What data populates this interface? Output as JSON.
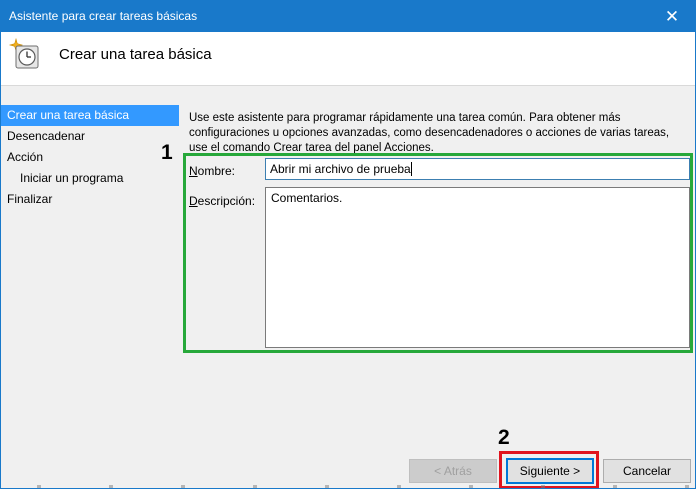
{
  "window": {
    "title": "Asistente para crear tareas básicas",
    "close_glyph": "✕"
  },
  "header": {
    "title": "Crear una tarea básica",
    "icon": "task-clock-icon"
  },
  "nav": {
    "items": [
      {
        "label": "Crear una tarea básica",
        "active": true
      },
      {
        "label": "Desencadenar"
      },
      {
        "label": "Acción"
      },
      {
        "label": "Iniciar un programa",
        "sub": true
      },
      {
        "label": "Finalizar"
      }
    ]
  },
  "main": {
    "intro": "Use este asistente para programar rápidamente una tarea común. Para obtener más configuraciones u opciones avanzadas, como desencadenadores o acciones de varias tareas, use el comando Crear tarea del panel Acciones.",
    "name_label": "Nombre:",
    "name_label_access": "N",
    "name_label_rest": "ombre:",
    "name_value": "Abrir mi archivo de prueba",
    "desc_label_access": "D",
    "desc_label_rest": "escripción:",
    "desc_value": "Comentarios."
  },
  "buttons": {
    "back": "< Atrás",
    "next": "Siguiente >",
    "cancel": "Cancelar"
  },
  "annotations": {
    "one": "1",
    "two": "2"
  },
  "colors": {
    "titlebar": "#1979ca",
    "nav_active": "#3399ff",
    "highlight_green": "#27a83a",
    "highlight_red": "#e0141e"
  }
}
